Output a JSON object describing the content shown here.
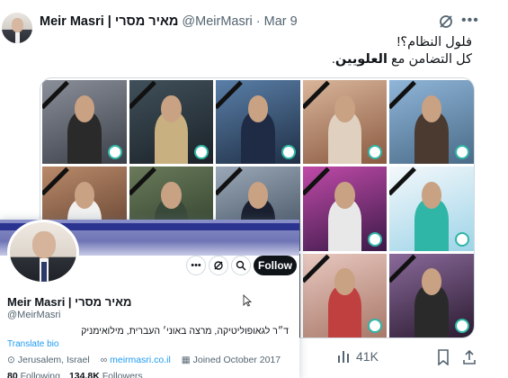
{
  "tweet": {
    "author_name": "Meir Masri | מאיר מסרי",
    "handle": "@MeirMasri",
    "separator": "·",
    "date": "Mar 9",
    "text_line1": "فلول النظام؟!",
    "text_line2_prefix": "كل التضامن مع ",
    "text_line2_bold": "العلويين",
    "text_line2_suffix": ".",
    "views": "41K"
  },
  "hover_card": {
    "name": "Meir Masri | מאיר מסרי",
    "handle": "@MeirMasri",
    "follow_label": "Follow",
    "bio": "ד״ר לגאופוליטיקה, מרצה באוני׳ העברית, מילואימניק",
    "translate_label": "Translate bio",
    "location": "Jerusalem, Israel",
    "website": "meirmasri.co.il",
    "joined": "Joined October 2017",
    "following_count": "80",
    "following_label": "Following",
    "followers_count": "134.8K",
    "followers_label": "Followers"
  },
  "icons": {
    "grok": "grok-icon",
    "more": "more-icon",
    "views": "bar-chart-icon",
    "bookmark": "bookmark-icon",
    "share": "share-icon",
    "location": "location-pin-icon",
    "link": "link-icon",
    "calendar": "calendar-icon"
  },
  "colors": {
    "accent": "#1d9bf0",
    "text": "#0f1419",
    "muted": "#536471",
    "badge": "#2fb6a6"
  }
}
